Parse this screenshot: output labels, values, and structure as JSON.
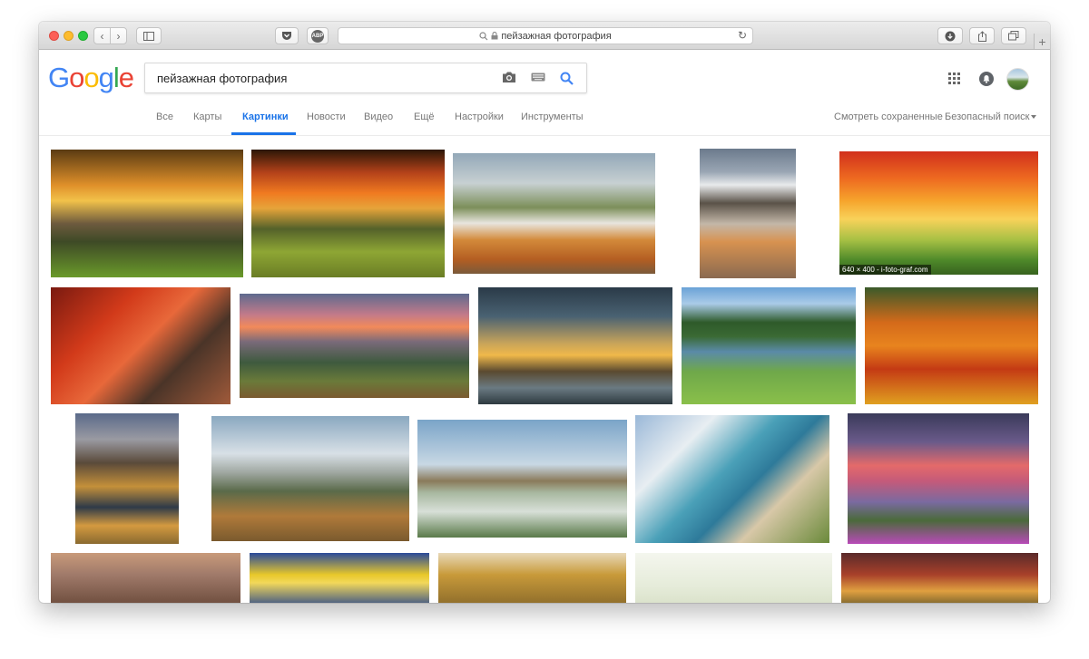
{
  "browser": {
    "address": "пейзажная фотография",
    "tb_labels": {
      "abp": "ABP"
    }
  },
  "logo": {
    "text": "Google",
    "colors": [
      "#4285f4",
      "#ea4335",
      "#fbbc05",
      "#4285f4",
      "#34a853",
      "#ea4335"
    ]
  },
  "search": {
    "query": "пейзажная фотография"
  },
  "tabs": [
    {
      "label": "Все"
    },
    {
      "label": "Карты"
    },
    {
      "label": "Картинки"
    },
    {
      "label": "Новости"
    },
    {
      "label": "Видео"
    },
    {
      "label": "Ещё"
    },
    {
      "label": "Настройки"
    },
    {
      "label": "Инструменты"
    }
  ],
  "right_links": {
    "saved": "Смотреть сохраненные",
    "safesearch": "Безопасный поиск"
  },
  "results": {
    "hover_caption": "640 × 400 - i-foto-graf.com"
  },
  "icons": {
    "camera": "camera-icon",
    "keyboard": "keyboard-icon",
    "search": "search-icon",
    "apps": "apps-grid-icon",
    "notifications": "notifications-icon"
  },
  "colors": {
    "accent": "#1a73e8"
  }
}
